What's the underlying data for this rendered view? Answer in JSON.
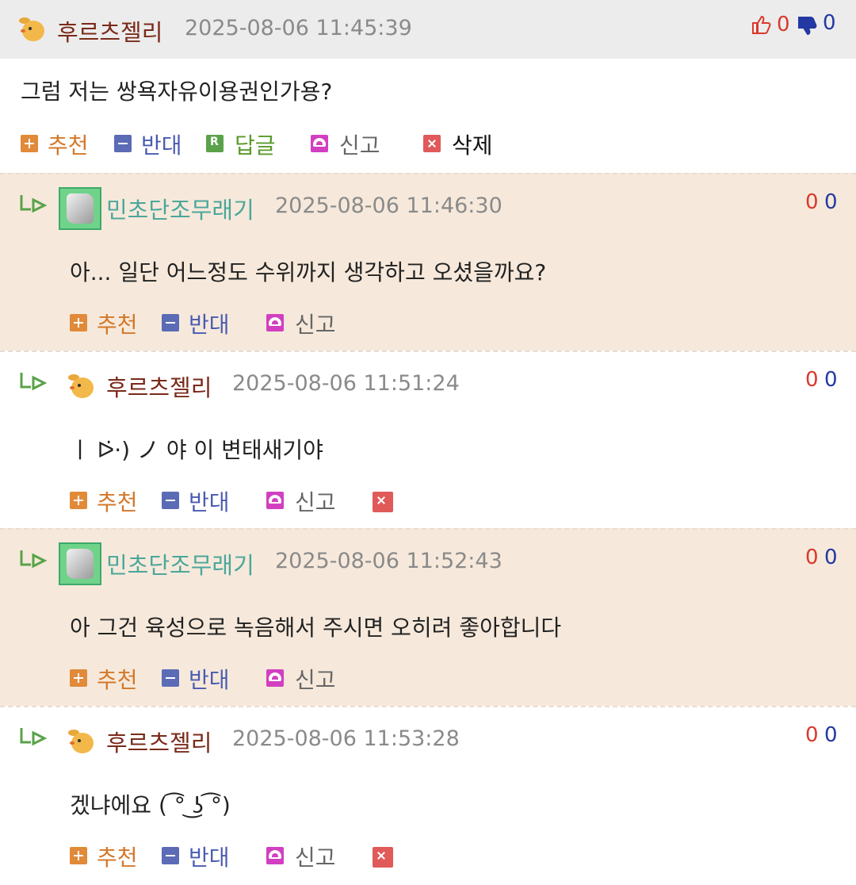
{
  "top": {
    "nickname": "후르츠젤리",
    "timestamp": "2025-08-06 11:45:39",
    "up_count": "0",
    "down_count": "0",
    "content": "그럼 저는 쌍욕자유이용권인가용?",
    "actions": {
      "recommend": "추천",
      "oppose": "반대",
      "reply": "답글",
      "report": "신고",
      "delete": "삭제"
    }
  },
  "replies": [
    {
      "nickname": "민초단조무래기",
      "timestamp": "2025-08-06 11:46:30",
      "up_count": "0",
      "down_count": "0",
      "content": "아... 일단 어느정도 수위까지 생각하고 오셨을까요?",
      "recommend": "추천",
      "oppose": "반대",
      "report": "신고"
    },
    {
      "nickname": "후르츠젤리",
      "timestamp": "2025-08-06 11:51:24",
      "up_count": "0",
      "down_count": "0",
      "content": "ㅣ ᐅ̇·) ノ 야 이 변태새기야",
      "recommend": "추천",
      "oppose": "반대",
      "report": "신고"
    },
    {
      "nickname": "민초단조무래기",
      "timestamp": "2025-08-06 11:52:43",
      "up_count": "0",
      "down_count": "0",
      "content": "아 그건 육성으로 녹음해서 주시면 오히려 좋아합니다",
      "recommend": "추천",
      "oppose": "반대",
      "report": "신고"
    },
    {
      "nickname": "후르츠젤리",
      "timestamp": "2025-08-06 11:53:28",
      "up_count": "0",
      "down_count": "0",
      "content": "겠냐에요 (  ͡° ͜ʖ ͡°)",
      "recommend": "추천",
      "oppose": "반대",
      "report": "신고"
    }
  ],
  "colors": {
    "header_bg": "#ececec",
    "reply_beige": "#f6e9db",
    "up": "#d83a2c",
    "down": "#2438a3"
  }
}
